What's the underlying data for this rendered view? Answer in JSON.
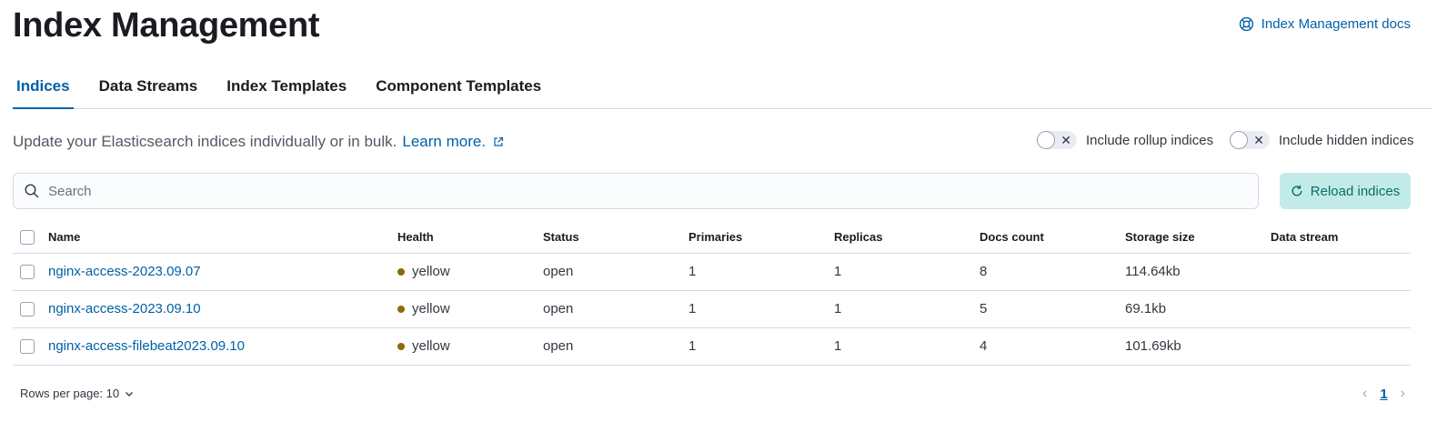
{
  "page": {
    "title": "Index Management",
    "docs_link": "Index Management docs"
  },
  "tabs": [
    {
      "label": "Indices",
      "active": true
    },
    {
      "label": "Data Streams",
      "active": false
    },
    {
      "label": "Index Templates",
      "active": false
    },
    {
      "label": "Component Templates",
      "active": false
    }
  ],
  "intro": {
    "text": "Update your Elasticsearch indices individually or in bulk.",
    "link": "Learn more."
  },
  "switches": {
    "rollup": {
      "label": "Include rollup indices",
      "on": false
    },
    "hidden": {
      "label": "Include hidden indices",
      "on": false
    }
  },
  "search": {
    "placeholder": "Search",
    "value": ""
  },
  "reload_button": "Reload indices",
  "table": {
    "columns": [
      "Name",
      "Health",
      "Status",
      "Primaries",
      "Replicas",
      "Docs count",
      "Storage size",
      "Data stream"
    ],
    "rows": [
      {
        "name": "nginx-access-2023.09.07",
        "health": "yellow",
        "status": "open",
        "primaries": "1",
        "replicas": "1",
        "docs": "8",
        "storage": "114.64kb",
        "stream": ""
      },
      {
        "name": "nginx-access-2023.09.10",
        "health": "yellow",
        "status": "open",
        "primaries": "1",
        "replicas": "1",
        "docs": "5",
        "storage": "69.1kb",
        "stream": ""
      },
      {
        "name": "nginx-access-filebeat2023.09.10",
        "health": "yellow",
        "status": "open",
        "primaries": "1",
        "replicas": "1",
        "docs": "4",
        "storage": "101.69kb",
        "stream": ""
      }
    ]
  },
  "footer": {
    "rows_per_page": "Rows per page: 10",
    "current_page": "1"
  },
  "colors": {
    "accent": "#0061a6",
    "health_yellow": "#8a6a0a",
    "reload_bg": "#c2ebe8",
    "reload_text": "#0b6e63"
  }
}
